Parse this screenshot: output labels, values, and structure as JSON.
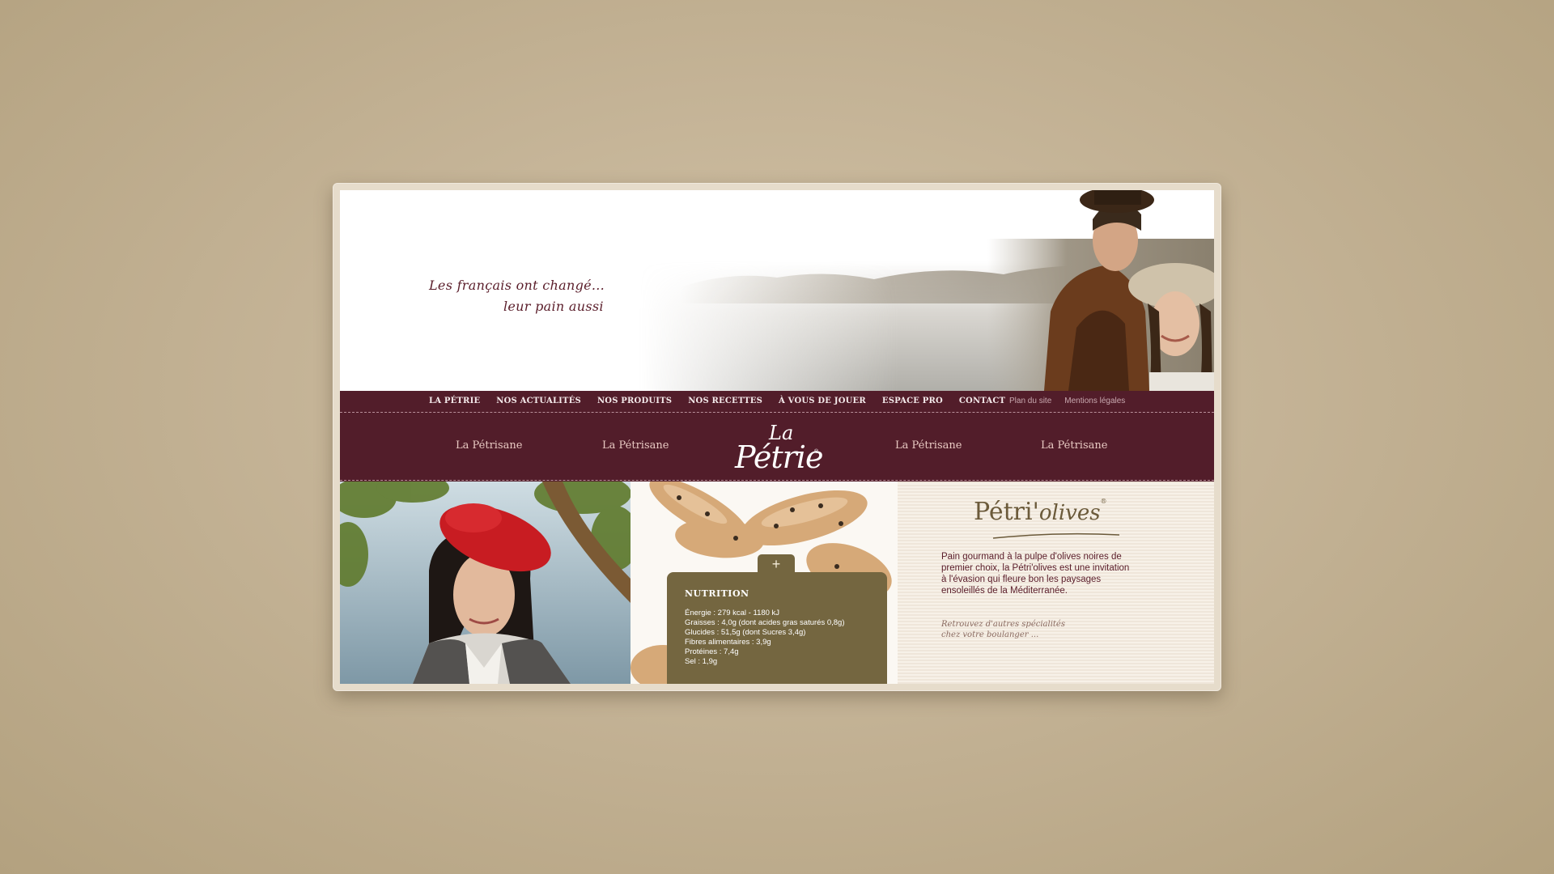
{
  "header": {
    "tagline_line1": "Les français ont changé...",
    "tagline_line2": "leur pain aussi"
  },
  "nav": {
    "main": [
      "LA PÉTRIE",
      "NOS ACTUALITÉS",
      "NOS PRODUITS",
      "NOS RECETTES",
      "À VOUS DE JOUER",
      "ESPACE PRO",
      "CONTACT"
    ],
    "utility": [
      "Plan du site",
      "Mentions légales"
    ]
  },
  "product_links": [
    "La Pétrisane",
    "La Pétrisane",
    "La Pétrisane",
    "La Pétrisane"
  ],
  "logo": {
    "la": "La",
    "name": "Pétrie",
    "reg": "®"
  },
  "product": {
    "title_main": "Pétri'",
    "title_script": "olives",
    "title_reg": "®",
    "description": "Pain gourmand à la pulpe d'olives noires de premier choix, la Pétri'olives est une invitation à l'évasion qui fleure bon les paysages ensoleillés de la Méditerranée.",
    "more_line1": "Retrouvez d'autres spécialités",
    "more_line2": "chez votre boulanger ..."
  },
  "nutrition": {
    "toggle_symbol": "+",
    "title": "NUTRITION",
    "items": [
      "Énergie : 279 kcal - 1180 kJ",
      "Graisses : 4,0g (dont acides gras saturés  0,8g)",
      "Glucides : 51,5g (dont Sucres 3,4g)",
      "Fibres alimentaires : 3,9g",
      "Protéines : 7,4g",
      "Sel : 1,9g"
    ]
  },
  "colors": {
    "background": "#c4b396",
    "brand_burgundy": "#521d2a",
    "nutrition_olive": "#746640",
    "title_brown": "#6b5a3a"
  }
}
